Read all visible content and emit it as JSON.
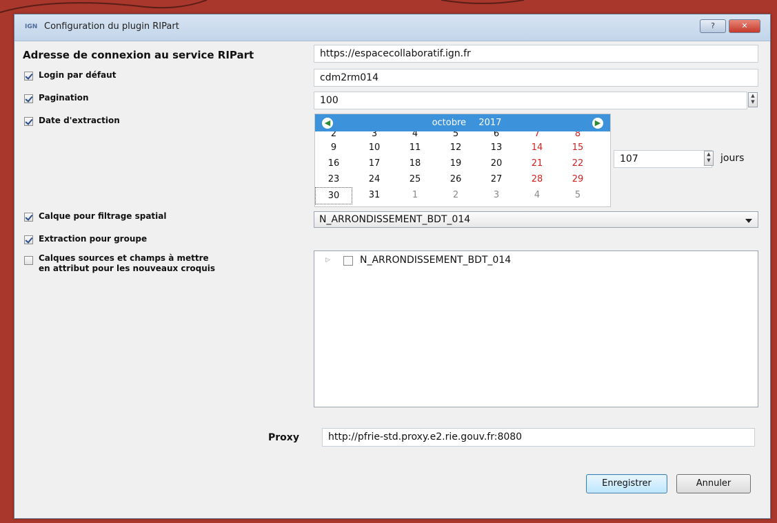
{
  "window": {
    "logo": "IGN",
    "title": "Configuration du plugin RIPart",
    "help_label": "?",
    "close_label": "✕"
  },
  "service": {
    "label": "Adresse de connexion au service RIPart",
    "value": "https://espacecollaboratif.ign.fr"
  },
  "login": {
    "label": "Login par défaut",
    "checked": true,
    "value": "cdm2rm014"
  },
  "pagination": {
    "label": "Pagination",
    "checked": true,
    "value": "100"
  },
  "date": {
    "label": "Date d'extraction",
    "checked": true,
    "month": "octobre",
    "year": "2017",
    "partial_row": [
      "2",
      "3",
      "4",
      "5",
      "6",
      "7",
      "8"
    ],
    "weeks": [
      [
        "9",
        "10",
        "11",
        "12",
        "13",
        "14",
        "15"
      ],
      [
        "16",
        "17",
        "18",
        "19",
        "20",
        "21",
        "22"
      ],
      [
        "23",
        "24",
        "25",
        "26",
        "27",
        "28",
        "29"
      ],
      [
        "30",
        "31",
        "1",
        "2",
        "3",
        "4",
        "5"
      ]
    ],
    "selected": "30",
    "days_value": "107",
    "days_unit": "jours"
  },
  "layer_filter": {
    "label": "Calque pour filtrage spatial",
    "checked": true,
    "value": "N_ARRONDISSEMENT_BDT_014"
  },
  "group_extract": {
    "label": "Extraction pour groupe",
    "checked": true
  },
  "source_layers": {
    "label_line1": "Calques sources et champs à mettre",
    "label_line2": "en attribut pour les nouveaux croquis",
    "checked": false,
    "tree_item": "N_ARRONDISSEMENT_BDT_014"
  },
  "proxy": {
    "label": "Proxy",
    "value": "http://pfrie-std.proxy.e2.rie.gouv.fr:8080"
  },
  "buttons": {
    "save": "Enregistrer",
    "cancel": "Annuler"
  },
  "colors": {
    "calendar_header": "#3c93dc",
    "weekend": "#d42020",
    "desktop": "#a9372c"
  }
}
